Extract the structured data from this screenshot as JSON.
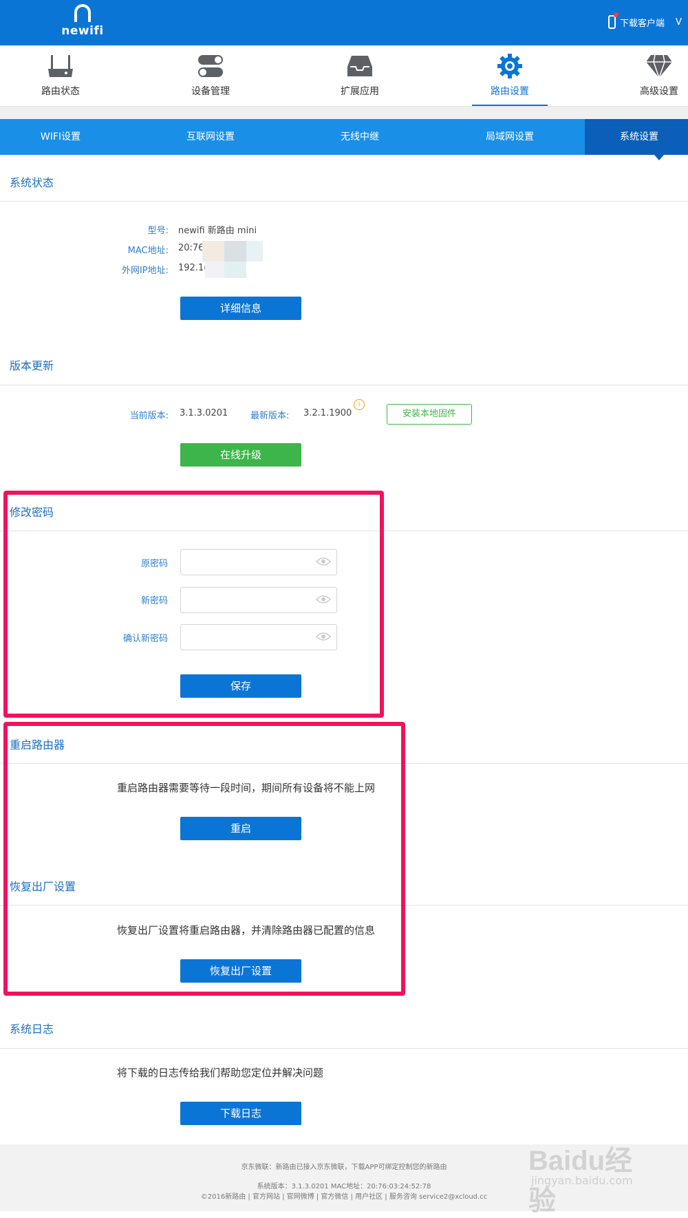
{
  "brand": {
    "logo_text": "newifi"
  },
  "topbar": {
    "download_label": "下载客户端",
    "user_initial": "V"
  },
  "main_nav": [
    {
      "label": "路由状态",
      "icon": "router-icon"
    },
    {
      "label": "设备管理",
      "icon": "toggle-icon"
    },
    {
      "label": "扩展应用",
      "icon": "inbox-icon"
    },
    {
      "label": "路由设置",
      "icon": "gear-icon",
      "active": true
    },
    {
      "label": "高级设置",
      "icon": "diamond-icon"
    }
  ],
  "sub_nav": [
    {
      "label": "WIFI设置"
    },
    {
      "label": "互联网设置"
    },
    {
      "label": "无线中继"
    },
    {
      "label": "局域网设置"
    },
    {
      "label": "系统设置",
      "active": true
    }
  ],
  "system_status": {
    "title": "系统状态",
    "model_label": "型号:",
    "model_value": "newifi 新路由 mini",
    "mac_label": "MAC地址:",
    "mac_value": "20:76",
    "wan_ip_label": "外网IP地址:",
    "wan_ip_value": "192.1(",
    "details_button": "详细信息"
  },
  "version_update": {
    "title": "版本更新",
    "current_label": "当前版本:",
    "current_value": "3.1.3.0201",
    "latest_label": "最新版本:",
    "latest_value": "3.2.1.1900",
    "info_icon": "i",
    "install_local_button": "安装本地固件",
    "online_upgrade_button": "在线升级"
  },
  "change_password": {
    "title": "修改密码",
    "old_label": "原密码",
    "new_label": "新密码",
    "confirm_label": "确认新密码",
    "old_value": "",
    "new_value": "",
    "confirm_value": "",
    "save_button": "保存"
  },
  "reboot": {
    "title": "重启路由器",
    "description": "重启路由器需要等待一段时间，期间所有设备将不能上网",
    "button": "重启"
  },
  "factory_reset": {
    "title": "恢复出厂设置",
    "description": "恢复出厂设置将重启路由器，并清除路由器已配置的信息",
    "button": "恢复出厂设置"
  },
  "system_log": {
    "title": "系统日志",
    "description": "将下载的日志传给我们帮助您定位并解决问题",
    "button": "下载日志"
  },
  "footer": {
    "line1": "京东微联：新路由已接入京东微联，下载APP可绑定控制您的新路由",
    "line2": "系统版本：3.1.3.0201  MAC地址：20:76:03:24:52:78",
    "line3": "©2016新路由  |  官方网站  |  官网微博  |  官方微信  |  用户社区  |  服务咨询 service2@xcloud.cc"
  },
  "watermark": {
    "text": "Baidu经验",
    "sub": "jingyan.baidu.com"
  },
  "colors": {
    "primary": "#0b75d6",
    "subnav": "#1a8fe8",
    "green": "#3db54a",
    "highlight": "#f0125f"
  }
}
